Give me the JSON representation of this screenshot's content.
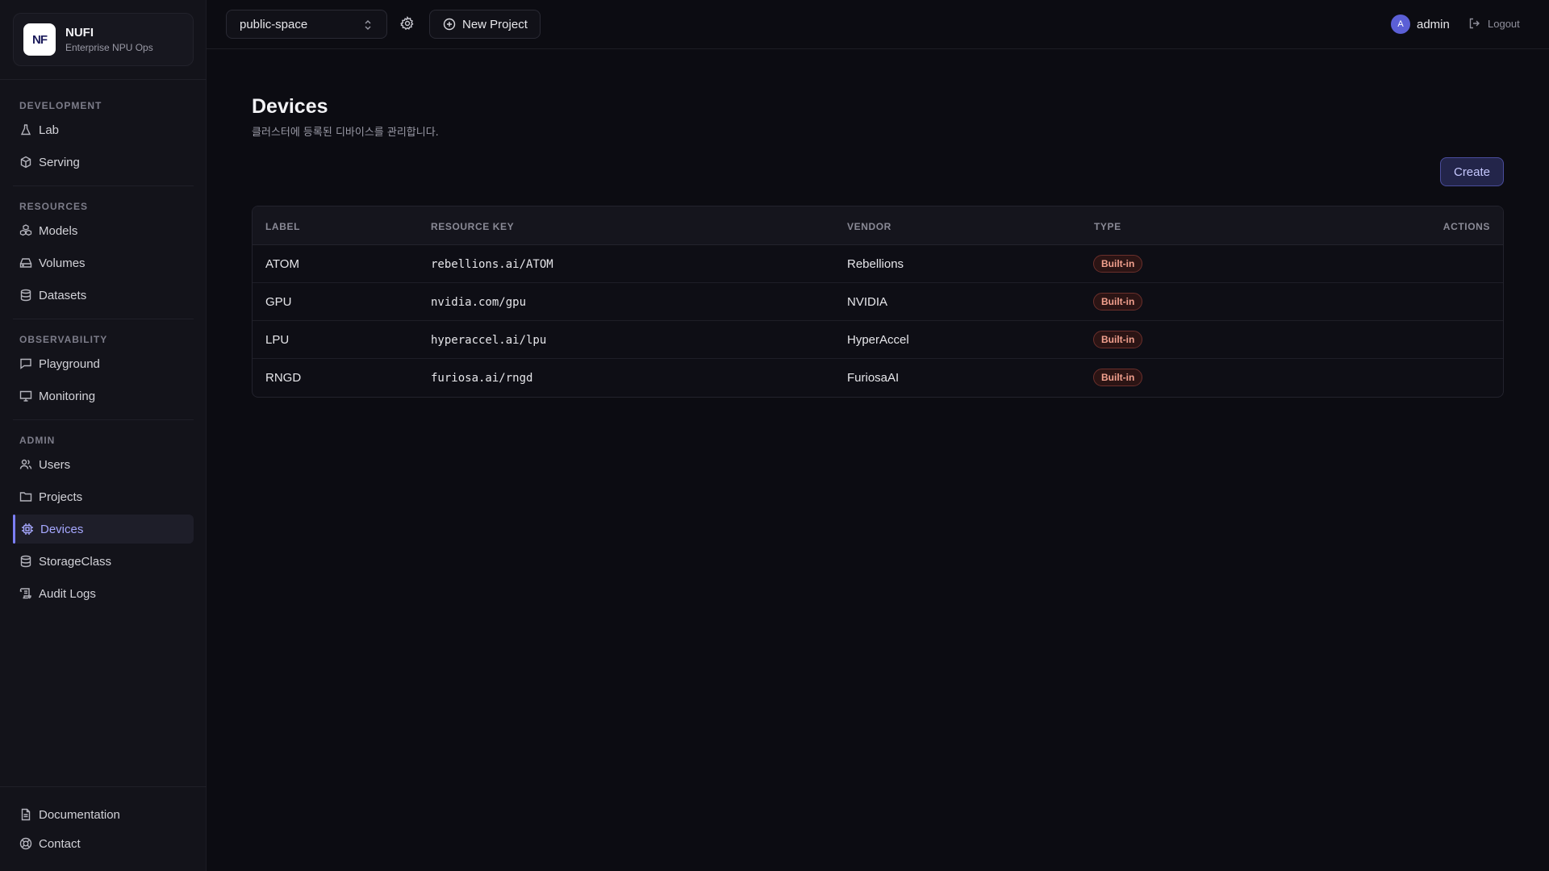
{
  "brand": {
    "name": "NUFI",
    "subtitle": "Enterprise NPU Ops",
    "logo_text": "NF"
  },
  "sidebar": {
    "sections": [
      {
        "title": "DEVELOPMENT",
        "items": [
          {
            "label": "Lab",
            "icon": "flask-icon"
          },
          {
            "label": "Serving",
            "icon": "cube-icon"
          }
        ]
      },
      {
        "title": "RESOURCES",
        "items": [
          {
            "label": "Models",
            "icon": "boxes-icon"
          },
          {
            "label": "Volumes",
            "icon": "hard-drive-icon"
          },
          {
            "label": "Datasets",
            "icon": "database-icon"
          }
        ]
      },
      {
        "title": "OBSERVABILITY",
        "items": [
          {
            "label": "Playground",
            "icon": "chat-icon"
          },
          {
            "label": "Monitoring",
            "icon": "monitor-icon"
          }
        ]
      },
      {
        "title": "ADMIN",
        "items": [
          {
            "label": "Users",
            "icon": "users-icon"
          },
          {
            "label": "Projects",
            "icon": "folder-icon"
          },
          {
            "label": "Devices",
            "icon": "chip-icon",
            "active": true
          },
          {
            "label": "StorageClass",
            "icon": "database-icon"
          },
          {
            "label": "Audit Logs",
            "icon": "scroll-icon"
          }
        ]
      }
    ],
    "footer": [
      {
        "label": "Documentation",
        "icon": "document-icon"
      },
      {
        "label": "Contact",
        "icon": "lifebuoy-icon"
      }
    ]
  },
  "topbar": {
    "project": "public-space",
    "new_project_label": "New Project",
    "user": {
      "initial": "A",
      "name": "admin"
    },
    "logout_label": "Logout"
  },
  "page": {
    "title": "Devices",
    "subtitle": "클러스터에 등록된 디바이스를 관리합니다.",
    "create_label": "Create"
  },
  "table": {
    "columns": [
      "LABEL",
      "RESOURCE KEY",
      "VENDOR",
      "TYPE",
      "ACTIONS"
    ],
    "rows": [
      {
        "label": "ATOM",
        "resource_key": "rebellions.ai/ATOM",
        "vendor": "Rebellions",
        "type": "Built-in"
      },
      {
        "label": "GPU",
        "resource_key": "nvidia.com/gpu",
        "vendor": "NVIDIA",
        "type": "Built-in"
      },
      {
        "label": "LPU",
        "resource_key": "hyperaccel.ai/lpu",
        "vendor": "HyperAccel",
        "type": "Built-in"
      },
      {
        "label": "RNGD",
        "resource_key": "furiosa.ai/rngd",
        "vendor": "FuriosaAI",
        "type": "Built-in"
      }
    ]
  },
  "colors": {
    "accent": "#7c7ff5",
    "badge_text": "#f2a08e",
    "background": "#0c0c12"
  }
}
